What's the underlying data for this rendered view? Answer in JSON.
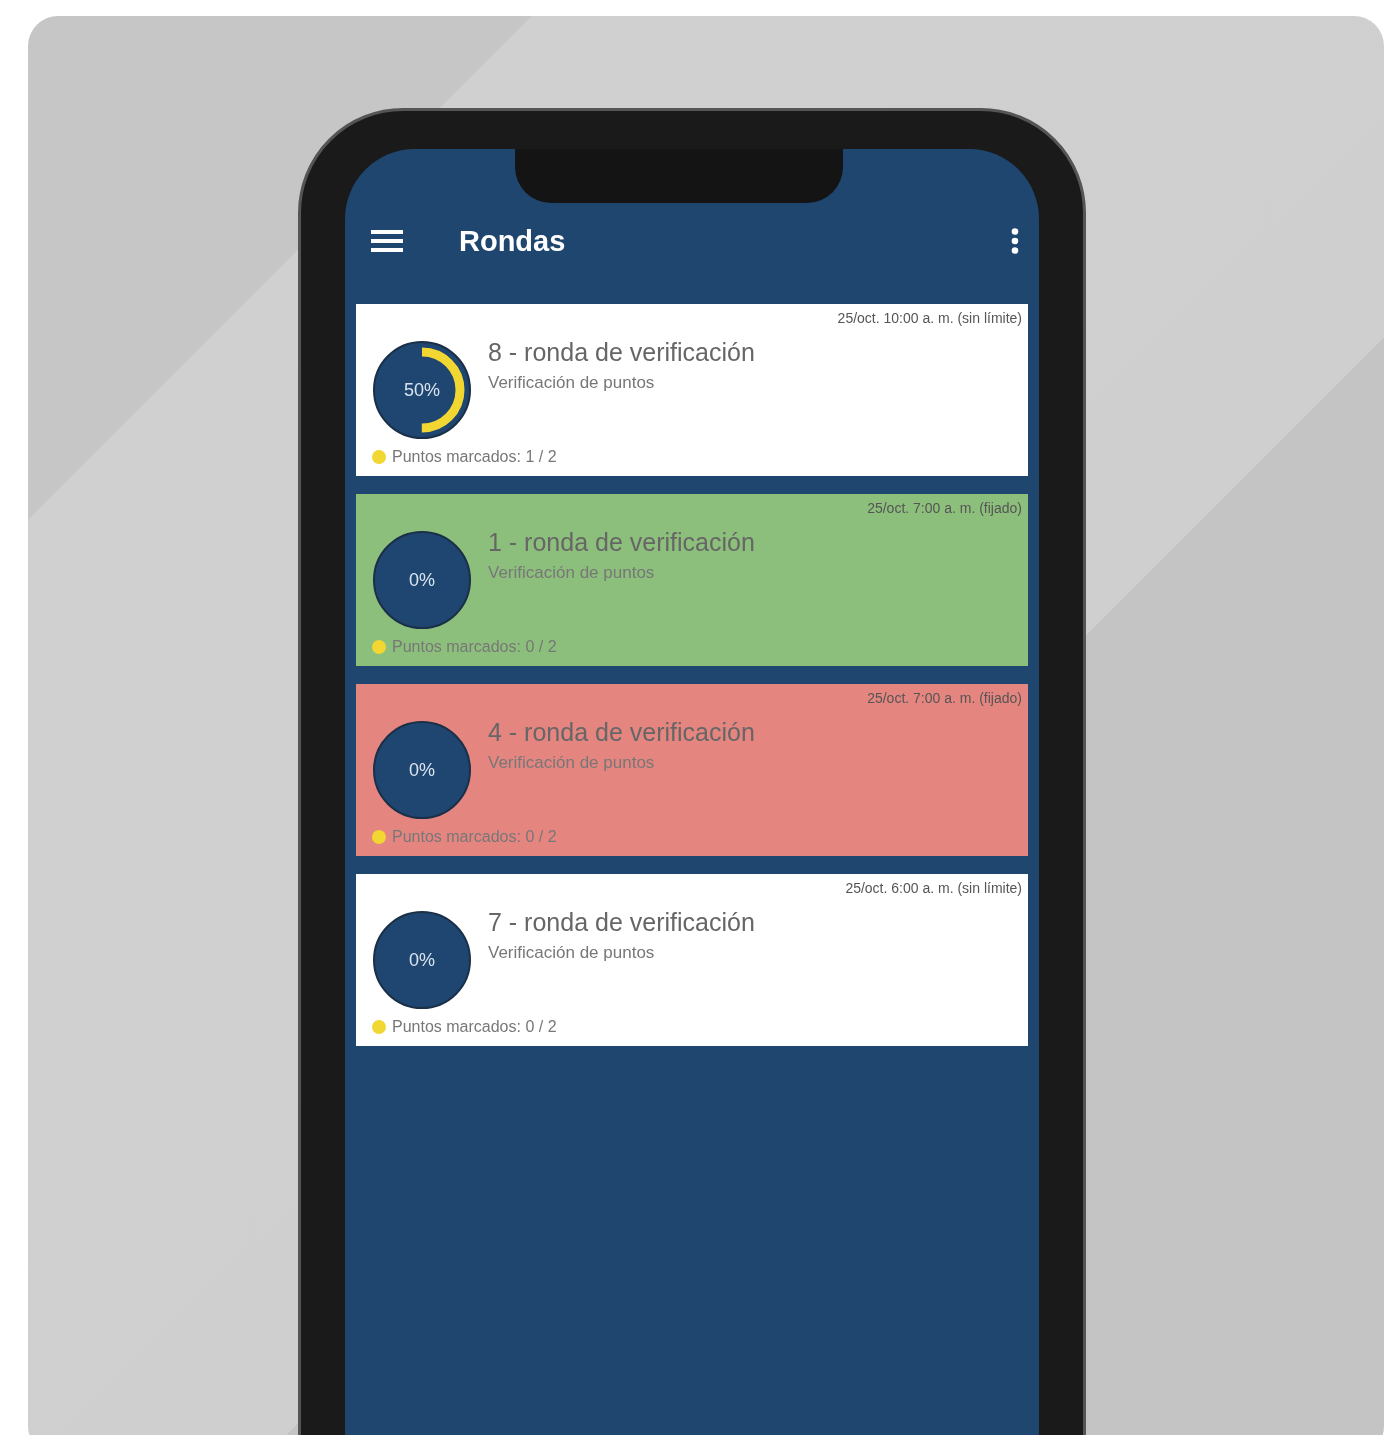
{
  "app_bar": {
    "title": "Rondas"
  },
  "rounds": [
    {
      "date": "25/oct. 10:00 a. m. (sin límite)",
      "title": "8 - ronda de verificación",
      "subtitle": "Verificación de puntos",
      "percent": "50%",
      "level": 0.5,
      "points": "Puntos marcados: 1 / 2",
      "color": "#ffffff"
    },
    {
      "date": "25/oct. 7:00 a. m. (fijado)",
      "title": "1 - ronda de verificación",
      "subtitle": "Verificación de puntos",
      "percent": "0%",
      "level": 0,
      "points": "Puntos marcados: 0 / 2",
      "color": "#8dbf7c"
    },
    {
      "date": "25/oct. 7:00 a. m. (fijado)",
      "title": "4 - ronda de verificación",
      "subtitle": "Verificación de puntos",
      "percent": "0%",
      "level": 0,
      "points": "Puntos marcados: 0 / 2",
      "color": "#e58580"
    },
    {
      "date": "25/oct. 6:00 a. m. (sin límite)",
      "title": "7 - ronda de verificación",
      "subtitle": "Verificación de puntos",
      "percent": "0%",
      "level": 0,
      "points": "Puntos marcados: 0 / 2",
      "color": "#ffffff"
    }
  ]
}
